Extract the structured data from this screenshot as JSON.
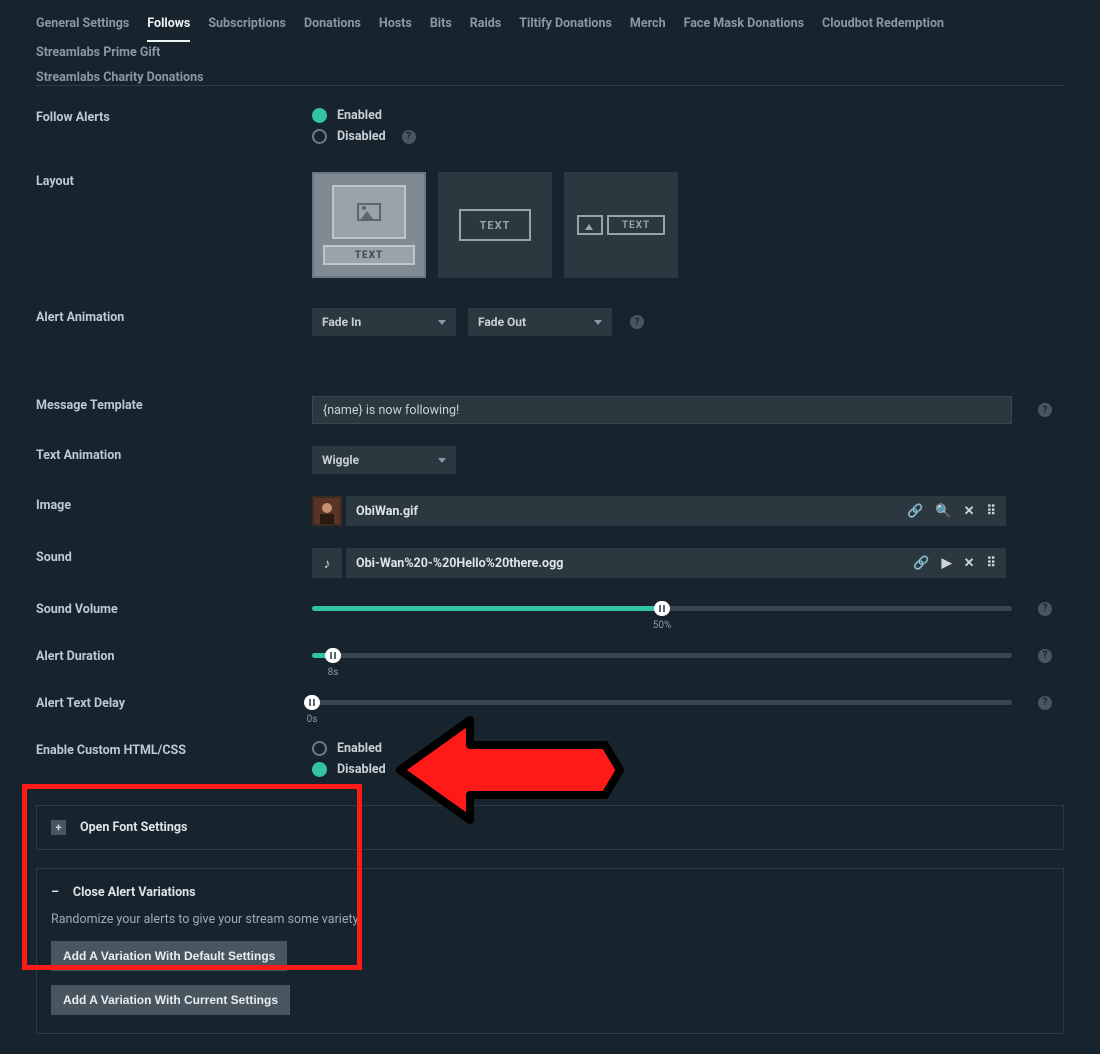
{
  "tabs": {
    "row1": [
      "General Settings",
      "Follows",
      "Subscriptions",
      "Donations",
      "Hosts",
      "Bits",
      "Raids",
      "Tiltify Donations",
      "Merch",
      "Face Mask Donations",
      "Cloudbot Redemption",
      "Streamlabs Prime Gift"
    ],
    "row2": [
      "Streamlabs Charity Donations"
    ],
    "active": "Follows"
  },
  "followAlerts": {
    "label": "Follow Alerts",
    "enabled": "Enabled",
    "disabled": "Disabled"
  },
  "layout": {
    "label": "Layout",
    "text_badge": "TEXT"
  },
  "alertAnimation": {
    "label": "Alert Animation",
    "in": "Fade In",
    "out": "Fade Out"
  },
  "messageTemplate": {
    "label": "Message Template",
    "value": "{name} is now following!"
  },
  "textAnimation": {
    "label": "Text Animation",
    "value": "Wiggle"
  },
  "image": {
    "label": "Image",
    "filename": "ObiWan.gif"
  },
  "sound": {
    "label": "Sound",
    "filename": "Obi-Wan%20-%20Hello%20there.ogg"
  },
  "soundVolume": {
    "label": "Sound Volume",
    "percent": 50,
    "display": "50%"
  },
  "alertDuration": {
    "label": "Alert Duration",
    "display": "8s",
    "percent": 3
  },
  "alertTextDelay": {
    "label": "Alert Text Delay",
    "display": "0s",
    "percent": 0
  },
  "customHtml": {
    "label": "Enable Custom HTML/CSS",
    "enabled": "Enabled",
    "disabled": "Disabled"
  },
  "fontSettings": {
    "label": "Open Font Settings"
  },
  "variations": {
    "title": "Close Alert Variations",
    "desc": "Randomize your alerts to give your stream some variety.",
    "btn_default": "Add A Variation With Default Settings",
    "btn_current": "Add A Variation With Current Settings"
  }
}
